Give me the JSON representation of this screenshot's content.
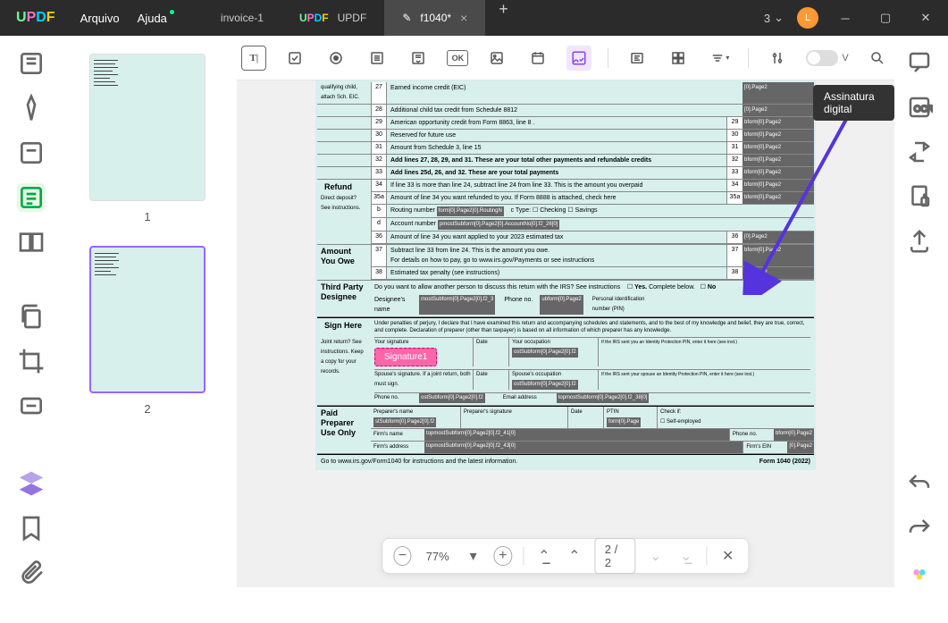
{
  "titlebar": {
    "logo": {
      "u": "U",
      "p": "P",
      "d": "D",
      "f": "F"
    },
    "menu": {
      "file": "Arquivo",
      "help": "Ajuda"
    },
    "tabs": [
      {
        "label": "invoice-1",
        "active": false
      },
      {
        "label": "UPDF",
        "active": false,
        "logo": true
      },
      {
        "label": "f1040*",
        "active": true,
        "closable": true
      }
    ],
    "account_badge": "3",
    "avatar_letter": "L"
  },
  "tooltip": "Assinatura digital",
  "thumbnails": {
    "page1_label": "1",
    "page2_label": "2"
  },
  "toolbar_top": {
    "text_tool": "T|",
    "ok_label": "OK",
    "toggle_v": "V"
  },
  "form": {
    "lines": {
      "qual_child": "qualifying child, attach Sch. EIC.",
      "l27": {
        "num": "27",
        "text": "Earned income credit (EIC)",
        "end": "[0].Page2"
      },
      "l28": {
        "num": "28",
        "text": "Additional child tax credit from Schedule 8812",
        "end": "[0].Page2"
      },
      "l29": {
        "num": "29",
        "text": "American opportunity credit from Form 8863, line 8 .",
        "endnum": "29",
        "end": "bform[0].Page2"
      },
      "l30": {
        "num": "30",
        "text": "Reserved for future use",
        "endnum": "30",
        "end": "bform[0].Page2"
      },
      "l31": {
        "num": "31",
        "text": "Amount from Schedule 3, line 15",
        "endnum": "31",
        "end": "bform[0].Page2"
      },
      "l32": {
        "num": "32",
        "text": "Add lines 27, 28, 29, and 31. These are your total other payments and refundable credits",
        "endnum": "32",
        "end": "bform[0].Page2"
      },
      "l33": {
        "num": "33",
        "text": "Add lines 25d, 26, and 32. These are your total payments",
        "endnum": "33",
        "end": "bform[0].Page2"
      }
    },
    "refund": {
      "title": "Refund",
      "sub": "Direct deposit? See instructions.",
      "l34": {
        "num": "34",
        "text": "If line 33 is more than line 24, subtract line 24 from line 33. This is the amount you overpaid",
        "endnum": "34",
        "end": "bform[0].Page2"
      },
      "l35a": {
        "num": "35a",
        "text": "Amount of line 34 you want refunded to you. If Form 8888 is attached, check here",
        "endnum": "35a",
        "end": "bform[0].Page2"
      },
      "l35b": {
        "num": "b",
        "text": "Routing number",
        "tag": "form[0].Page2[0].RoutingN",
        "type": "c Type:",
        "chk": "Checking",
        "sav": "Savings"
      },
      "l35d": {
        "num": "d",
        "text": "Account number",
        "tag": "pmostSubform[0].Page2[0].AccountNo[0].f2_26[0]"
      },
      "l36": {
        "num": "36",
        "text": "Amount of line 34 you want applied to your 2023 estimated tax",
        "endnum": "36",
        "end": "[0].Page2"
      }
    },
    "amount_owe": {
      "title": "Amount You Owe",
      "l37": {
        "num": "37",
        "text1": "Subtract line 33 from line 24. This is the amount you owe.",
        "text2": "For details on how to pay, go to www.irs.gov/Payments or see instructions",
        "endnum": "37",
        "end": "bform[0].Page2"
      },
      "l38": {
        "num": "38",
        "text": "Estimated tax penalty (see instructions)",
        "endnum": "38",
        "end": "[0].Page2"
      }
    },
    "third_party": {
      "title": "Third Party Designee",
      "q": "Do you want to allow another person to discuss this return with the IRS? See instructions",
      "yes": "Yes.",
      "yes2": "Complete below.",
      "no": "No",
      "name": "Designee's name",
      "tag1": "mostSubform[0].Page2[0].f2_3",
      "phone": "Phone no.",
      "tag2": "ubform[0].Page2",
      "pin": "Personal identification number (PIN)"
    },
    "sign": {
      "title": "Sign Here",
      "sub": "Joint return? See instructions. Keep a copy for your records.",
      "declaration": "Under penalties of perjury, I declare that I have examined this return and accompanying schedules and statements, and to the best of my knowledge and belief, they are true, correct, and complete. Declaration of preparer (other than taxpayer) is based on all information of which preparer has any knowledge.",
      "your_sig": "Your signature",
      "sig_box": "Signature1",
      "date": "Date",
      "occupation": "Your occupation",
      "tag_occ": "ostSubform[0].Page2[0].f2",
      "irs_pin": "If the IRS sent you an Identity Protection PIN, enter it here (see inst.)",
      "spouse_sig": "Spouse's signature. If a joint return, both must sign.",
      "spouse_occ": "Spouse's occupation",
      "tag_socc": "ostSubform[0].Page2[0].f2",
      "spouse_pin": "If the IRS sent your spouse an Identity Protection PIN, enter it here (see inst.)",
      "phone": "Phone no.",
      "tag_phone": "ostSubform[0].Page2[0].f2",
      "email": "Email address",
      "tag_email": "topmostSubform[0].Page2[0].f2_38[0]"
    },
    "preparer": {
      "title": "Paid Preparer Use Only",
      "name": "Preparer's name",
      "tag_name": "stSubform[0].Page2[0].f2",
      "sig": "Preparer's signature",
      "date": "Date",
      "ptin": "PTIN",
      "tag_ptin": "form[0].Page",
      "check": "Check if:",
      "self": "Self-employed",
      "firm": "Firm's name",
      "tag_firm": "topmostSubform[0].Page2[0].f2_41[0]",
      "phone": "Phone no.",
      "tag_phone": "bform[0].Page2",
      "addr": "Firm's address",
      "tag_addr": "topmostSubform[0].Page2[0].f2_43[0]",
      "ein": "Firm's EIN",
      "tag_ein": "[0].Page2"
    },
    "footer": "Go to www.irs.gov/Form1040 for instructions and the latest information.",
    "footer_right": "Form 1040 (2022)"
  },
  "bottom_bar": {
    "zoom": "77%",
    "page": "2  /  2"
  }
}
